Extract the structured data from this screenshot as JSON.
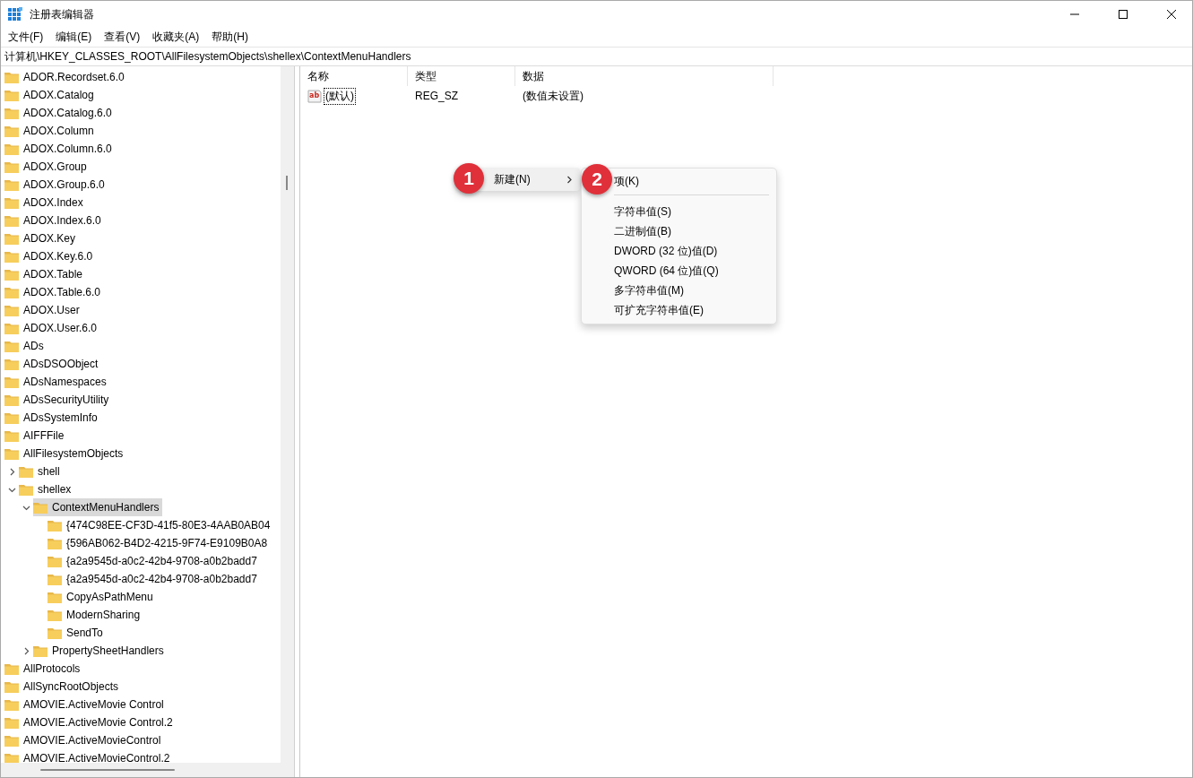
{
  "window": {
    "title": "注册表编辑器"
  },
  "menu_bar": [
    "文件(F)",
    "编辑(E)",
    "查看(V)",
    "收藏夹(A)",
    "帮助(H)"
  ],
  "address": "计算机\\HKEY_CLASSES_ROOT\\AllFilesystemObjects\\shellex\\ContextMenuHandlers",
  "tree": [
    {
      "label": "ADOR.Recordset.6.0",
      "selected": false
    },
    {
      "label": "ADOX.Catalog",
      "selected": false
    },
    {
      "label": "ADOX.Catalog.6.0",
      "selected": false
    },
    {
      "label": "ADOX.Column",
      "selected": false
    },
    {
      "label": "ADOX.Column.6.0",
      "selected": false
    },
    {
      "label": "ADOX.Group",
      "selected": false
    },
    {
      "label": "ADOX.Group.6.0",
      "selected": false
    },
    {
      "label": "ADOX.Index",
      "selected": false
    },
    {
      "label": "ADOX.Index.6.0",
      "selected": false
    },
    {
      "label": "ADOX.Key",
      "selected": false
    },
    {
      "label": "ADOX.Key.6.0",
      "selected": false
    },
    {
      "label": "ADOX.Table",
      "selected": false
    },
    {
      "label": "ADOX.Table.6.0",
      "selected": false
    },
    {
      "label": "ADOX.User",
      "selected": false
    },
    {
      "label": "ADOX.User.6.0",
      "selected": false
    },
    {
      "label": "ADs",
      "selected": false
    },
    {
      "label": "ADsDSOObject",
      "selected": false
    },
    {
      "label": "ADsNamespaces",
      "selected": false
    },
    {
      "label": "ADsSecurityUtility",
      "selected": false
    },
    {
      "label": "ADsSystemInfo",
      "selected": false
    },
    {
      "label": "AIFFFile",
      "selected": false
    },
    {
      "label": "AllFilesystemObjects",
      "selected": false,
      "children": [
        {
          "label": "shell",
          "selected": false,
          "expanded": false
        },
        {
          "label": "shellex",
          "selected": false,
          "expanded": true,
          "children": [
            {
              "label": "ContextMenuHandlers",
              "selected": true,
              "expanded": true,
              "children": [
                {
                  "label": "{474C98EE-CF3D-41f5-80E3-4AAB0AB04",
                  "selected": false
                },
                {
                  "label": "{596AB062-B4D2-4215-9F74-E9109B0A8",
                  "selected": false
                },
                {
                  "label": "{a2a9545d-a0c2-42b4-9708-a0b2badd7",
                  "selected": false
                },
                {
                  "label": "{a2a9545d-a0c2-42b4-9708-a0b2badd7",
                  "selected": false
                },
                {
                  "label": "CopyAsPathMenu",
                  "selected": false
                },
                {
                  "label": "ModernSharing",
                  "selected": false
                },
                {
                  "label": "SendTo",
                  "selected": false
                }
              ]
            },
            {
              "label": "PropertySheetHandlers",
              "selected": false,
              "expanded": false
            }
          ]
        }
      ]
    },
    {
      "label": "AllProtocols",
      "selected": false
    },
    {
      "label": "AllSyncRootObjects",
      "selected": false
    },
    {
      "label": "AMOVIE.ActiveMovie Control",
      "selected": false
    },
    {
      "label": "AMOVIE.ActiveMovie Control.2",
      "selected": false
    },
    {
      "label": "AMOVIE.ActiveMovieControl",
      "selected": false
    },
    {
      "label": "AMOVIE.ActiveMovieControl.2",
      "selected": false
    }
  ],
  "table": {
    "columns": [
      "名称",
      "类型",
      "数据"
    ],
    "rows": [
      {
        "icon_text": "ab",
        "name": "(默认)",
        "type": "REG_SZ",
        "data": "(数值未设置)"
      }
    ]
  },
  "context_menu": {
    "item": "新建(N)",
    "callout": "1",
    "submenu": {
      "callout": "2",
      "items": [
        {
          "kind": "item",
          "label": "项(K)"
        },
        {
          "kind": "separator"
        },
        {
          "kind": "item",
          "label": "字符串值(S)"
        },
        {
          "kind": "item",
          "label": "二进制值(B)"
        },
        {
          "kind": "item",
          "label": "DWORD (32 位)值(D)"
        },
        {
          "kind": "item",
          "label": "QWORD (64 位)值(Q)"
        },
        {
          "kind": "item",
          "label": "多字符串值(M)"
        },
        {
          "kind": "item",
          "label": "可扩充字符串值(E)"
        }
      ]
    }
  }
}
